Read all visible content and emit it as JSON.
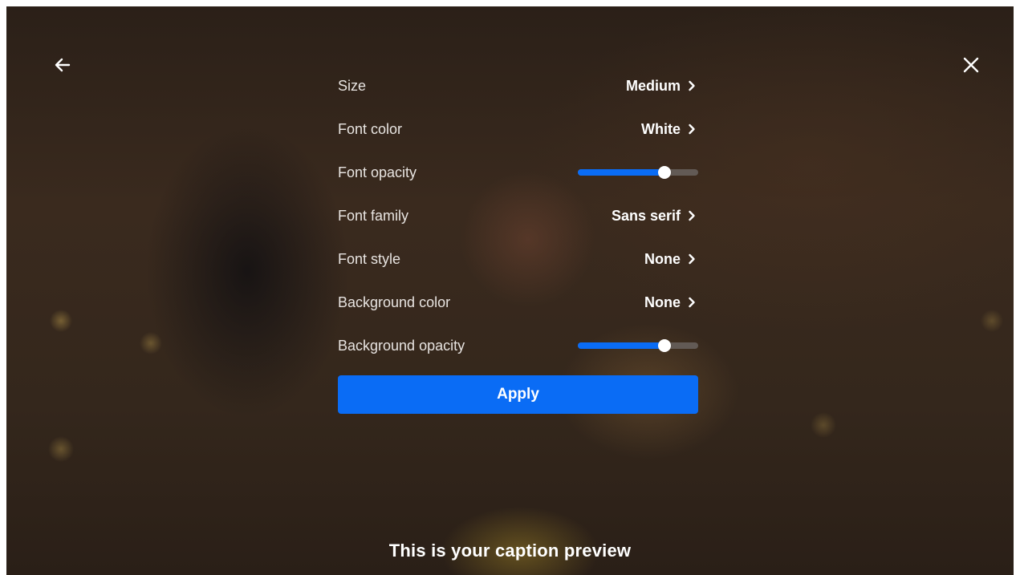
{
  "header": {
    "back_icon": "arrow-left-icon",
    "close_icon": "close-icon"
  },
  "settings": {
    "size": {
      "label": "Size",
      "value": "Medium"
    },
    "font_color": {
      "label": "Font color",
      "value": "White"
    },
    "font_opacity": {
      "label": "Font opacity",
      "level": 0.72
    },
    "font_family": {
      "label": "Font family",
      "value": "Sans serif"
    },
    "font_style": {
      "label": "Font style",
      "value": "None"
    },
    "background_color": {
      "label": "Background color",
      "value": "None"
    },
    "background_opacity": {
      "label": "Background opacity",
      "level": 0.72
    }
  },
  "apply_label": "Apply",
  "caption_preview": "This is your caption preview",
  "colors": {
    "accent": "#0a6cf5",
    "track": "#625a55",
    "text": "#ffffff"
  }
}
